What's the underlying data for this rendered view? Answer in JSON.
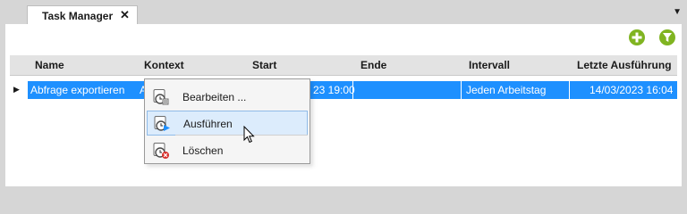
{
  "tab": {
    "title": "Task Manager",
    "close_glyph": "✕"
  },
  "overflow_glyph": "▼",
  "toolbar": {
    "add_icon": "plus-circle-icon",
    "filter_icon": "filter-icon",
    "accent": "#80b421"
  },
  "columns": [
    "Name",
    "Kontext",
    "Start",
    "Ende",
    "Intervall",
    "Letzte Ausführung"
  ],
  "rows": [
    {
      "name": "Abfrage exportieren",
      "kontext": "A",
      "start": "23 19:00",
      "ende": "",
      "intervall": "Jeden Arbeitstag",
      "letzte": "14/03/2023 16:04",
      "selected": true
    }
  ],
  "row_expander_glyph": "▶",
  "selection_color": "#1e90ff",
  "context_menu": {
    "items": [
      {
        "label": "Bearbeiten ...",
        "icon": "clock-edit-icon"
      },
      {
        "label": "Ausführen",
        "icon": "clock-run-icon",
        "highlighted": true
      },
      {
        "label": "Löschen",
        "icon": "clock-delete-icon"
      }
    ]
  }
}
